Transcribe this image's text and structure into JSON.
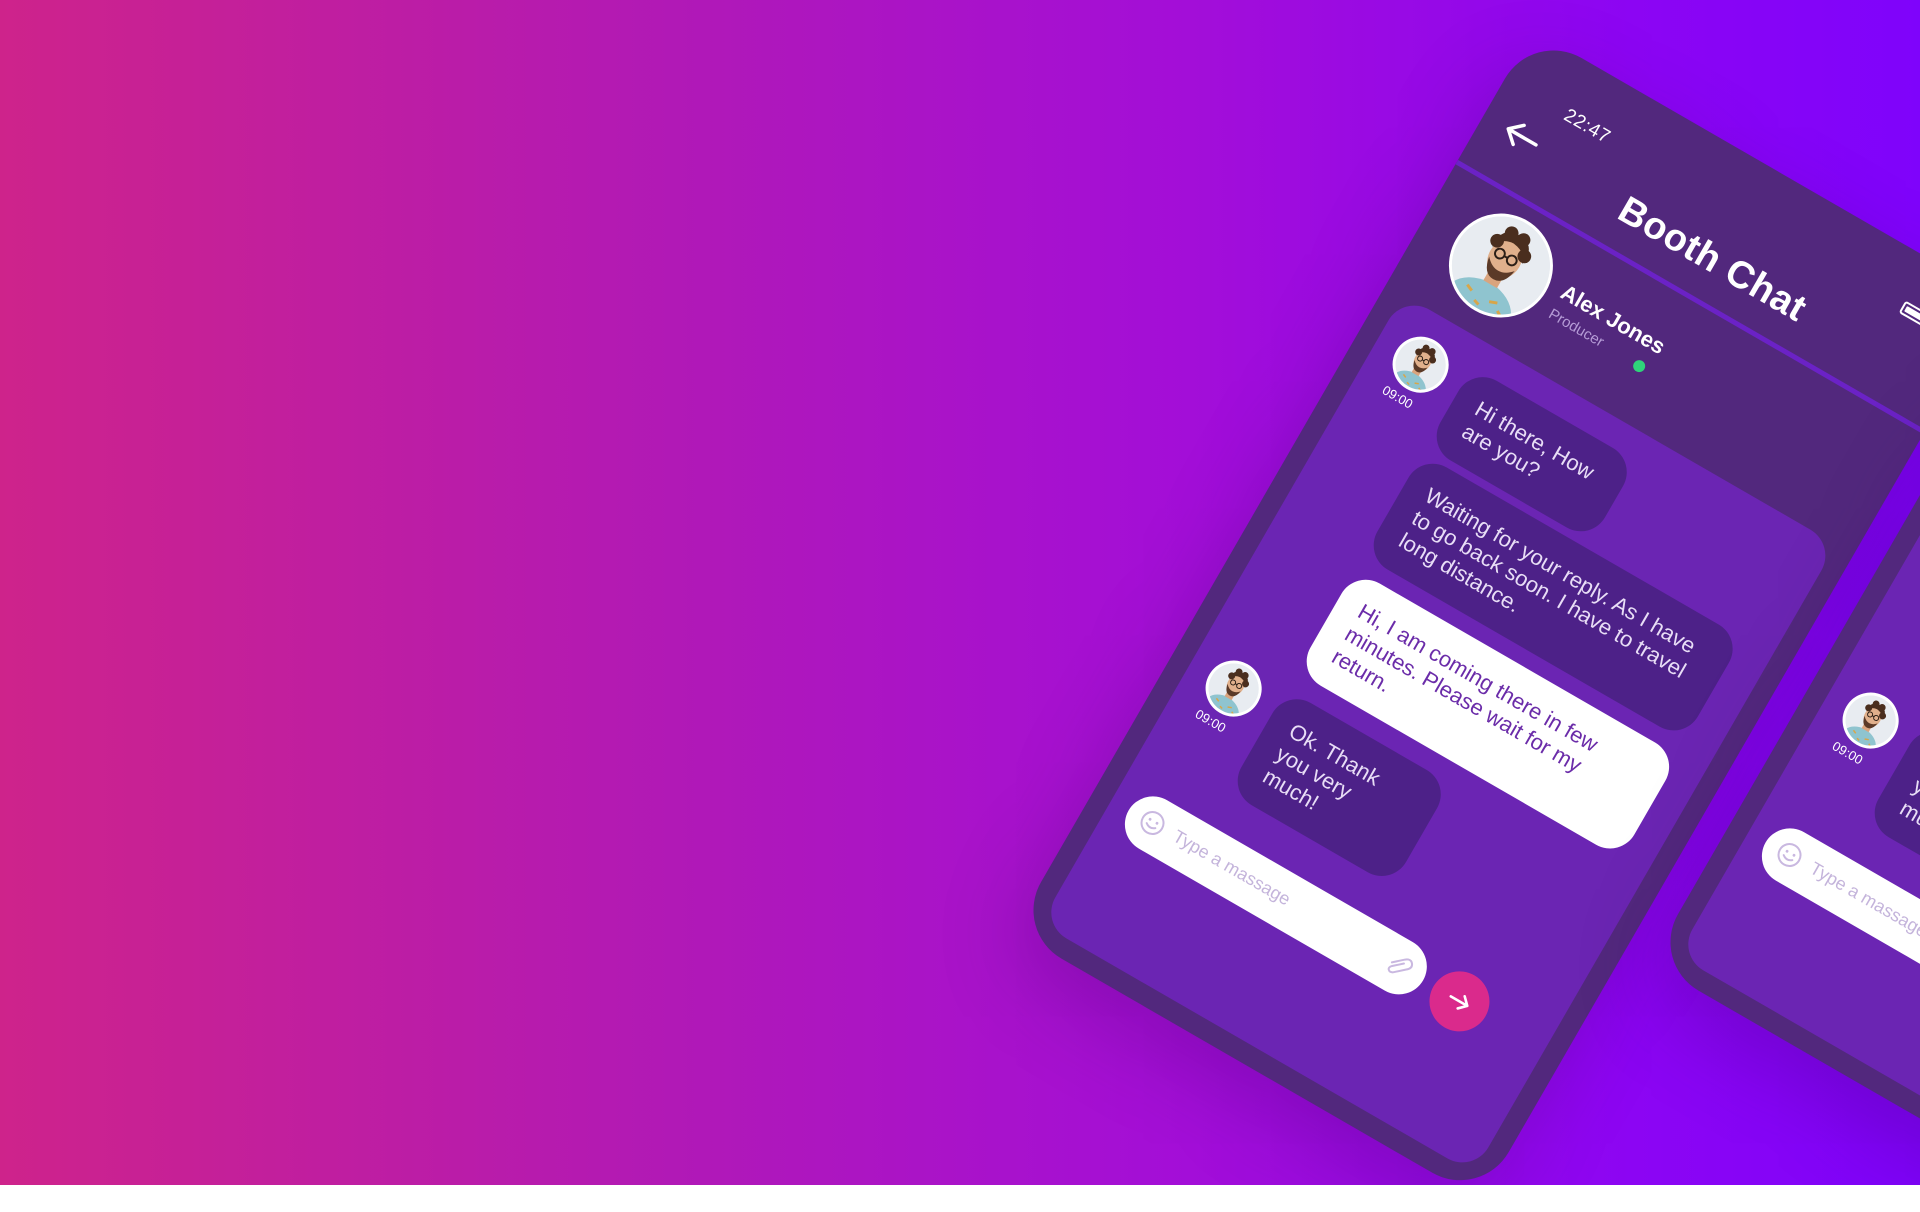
{
  "status": {
    "time": "22:47"
  },
  "header": {
    "title": "Booth Chat"
  },
  "contact": {
    "name": "Alex Jones",
    "role": "Producer"
  },
  "messages": [
    {
      "sender": "contact",
      "time": "09:00",
      "text": "Hi there, How are you?"
    },
    {
      "sender": "contact",
      "text": "Waiting for your reply. As I have to go back soon. I have to travel long distance."
    },
    {
      "sender": "me",
      "text": "Hi, I am coming there in few minutes. Please wait for my return."
    },
    {
      "sender": "contact",
      "time": "09:00",
      "text": "Ok. Thank you very much!"
    }
  ],
  "composer": {
    "placeholder": "Type a massage"
  },
  "icons": {
    "back": "back-arrow-icon",
    "send": "send-arrow-icon",
    "emoji": "emoji-icon",
    "attach": "paperclip-icon",
    "battery": "battery-icon"
  },
  "colors": {
    "phone_body": "#52287d",
    "chat_panel": "#6b25b3",
    "incoming_bubble": "#4d2188",
    "send_button": "#da2a8c",
    "online": "#2fd37a"
  }
}
